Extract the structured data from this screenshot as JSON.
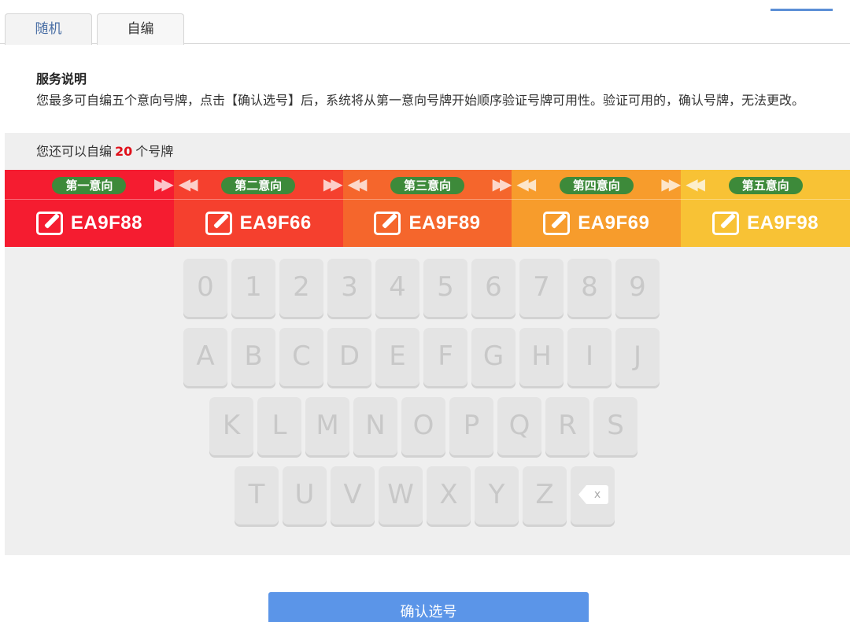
{
  "tabs": [
    {
      "label": "随机",
      "active": false
    },
    {
      "label": "自编",
      "active": true
    }
  ],
  "service": {
    "title": "服务说明",
    "text": "您最多可自编五个意向号牌，点击【确认选号】后，系统将从第一意向号牌开始顺序验证号牌可用性。验证可用的，确认号牌，无法更改。"
  },
  "remaining": {
    "prefix": "您还可以自编",
    "count": "20",
    "suffix": "个号牌"
  },
  "plates": [
    {
      "label": "第一意向",
      "code": "EA9F88",
      "color": "#f51c30"
    },
    {
      "label": "第二意向",
      "code": "EA9F66",
      "color": "#f5402e"
    },
    {
      "label": "第三意向",
      "code": "EA9F89",
      "color": "#f5662c"
    },
    {
      "label": "第四意向",
      "code": "EA9F69",
      "color": "#f79c2c"
    },
    {
      "label": "第五意向",
      "code": "EA9F98",
      "color": "#f8c235"
    }
  ],
  "keyboard": {
    "row1": [
      "0",
      "1",
      "2",
      "3",
      "4",
      "5",
      "6",
      "7",
      "8",
      "9"
    ],
    "row2": [
      "A",
      "B",
      "C",
      "D",
      "E",
      "F",
      "G",
      "H",
      "I",
      "J"
    ],
    "row3": [
      "K",
      "L",
      "M",
      "N",
      "O",
      "P",
      "Q",
      "R",
      "S"
    ],
    "row4": [
      "T",
      "U",
      "V",
      "W",
      "X",
      "Y",
      "Z"
    ],
    "delete_icon": "backspace-icon",
    "delete_glyph": "x"
  },
  "confirm_label": "确认选号"
}
